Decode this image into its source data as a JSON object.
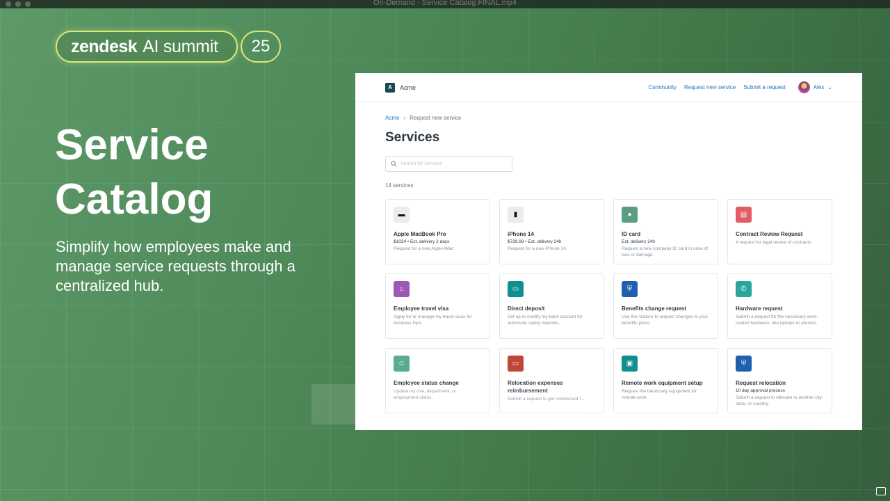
{
  "video": {
    "title": "On-Demand - Service Catalog FINAL.mp4"
  },
  "brand": {
    "name": "zendesk",
    "event": "AI summit",
    "year": "25"
  },
  "hero": {
    "title_line1": "Service",
    "title_line2": "Catalog",
    "subtitle": "Simplify how employees make and manage service requests through a centralized hub."
  },
  "app": {
    "logo_letter": "A",
    "name": "Acme",
    "nav": [
      "Community",
      "Request new service",
      "Submit a request"
    ],
    "user": "Alex",
    "breadcrumb": [
      "Acme",
      "Request new service"
    ],
    "page_title": "Services",
    "search_placeholder": "Search for services",
    "count": "14 services",
    "services": [
      {
        "title": "Apple MacBook Pro",
        "meta": "$1024  •  Est. delivery 2 days",
        "desc": "Request for a new Apple iMac",
        "icon": "laptop-icon",
        "color": "#ececec"
      },
      {
        "title": "iPhone 14",
        "meta": "$729.99  •  Est. delivery 24h",
        "desc": "Request for a new iPhone 14.",
        "icon": "phone-icon",
        "color": "#ececec"
      },
      {
        "title": "ID card",
        "meta": "Est. delivery 24h",
        "desc": "Request a new company ID card in case of loss or damage.",
        "icon": "id-card-icon",
        "color": "#5a9e82"
      },
      {
        "title": "Contract Review Request",
        "meta": "",
        "desc": "A request for legal review of contracts.",
        "icon": "contract-icon",
        "color": "#e35b66"
      },
      {
        "title": "Employee travel visa",
        "meta": "",
        "desc": "Apply for or manage my travel visas for business trips.",
        "icon": "travel-icon",
        "color": "#9b59b6"
      },
      {
        "title": "Direct deposit",
        "meta": "",
        "desc": "Set up or modify my bank account for automatic salary deposits.",
        "icon": "deposit-icon",
        "color": "#0f8f8f"
      },
      {
        "title": "Benefits change request",
        "meta": "",
        "desc": "Use this feature to request changes to your benefits plans.",
        "icon": "shield-icon",
        "color": "#1f5fb0"
      },
      {
        "title": "Hardware request",
        "meta": "",
        "desc": "Submit a request for the necessary work-related hardware, like laptops or phones.",
        "icon": "phone-call-icon",
        "color": "#2aa79b"
      },
      {
        "title": "Employee status change",
        "meta": "",
        "desc": "Update my role, department, or employment status.",
        "icon": "user-add-icon",
        "color": "#5aab8f"
      },
      {
        "title": "Relocation expenses reimbursement",
        "meta": "",
        "desc": "Submit a request to get reimbursed f...",
        "icon": "card-icon",
        "color": "#c0463a"
      },
      {
        "title": "Remote work equipment setup",
        "meta": "",
        "desc": "Request the necessary equipment for remote work",
        "icon": "monitor-icon",
        "color": "#0f8f8f"
      },
      {
        "title": "Request relocation",
        "meta": "10 day approval process",
        "desc": "Submit a request to relocate to another city, state, or country.",
        "icon": "shield-icon",
        "color": "#1f5fb0"
      }
    ]
  }
}
